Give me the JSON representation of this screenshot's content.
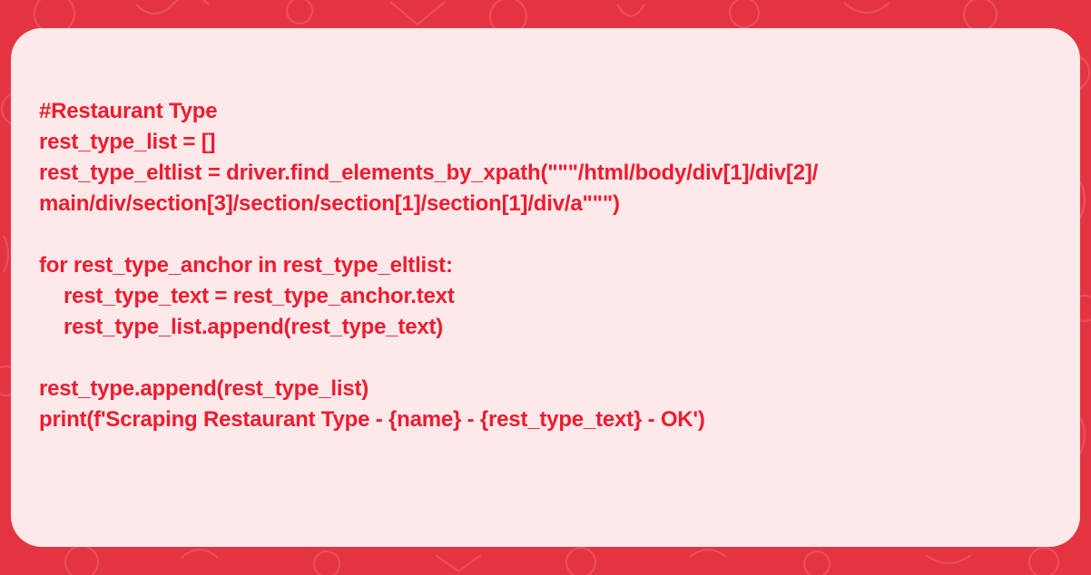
{
  "colors": {
    "background": "#e53441",
    "card": "#fde8ea",
    "code_text": "#ee1c2f"
  },
  "code": {
    "lines": [
      "#Restaurant Type",
      "rest_type_list = []",
      "rest_type_eltlist = driver.find_elements_by_xpath(\"\"\"/html/body/div[1]/div[2]/",
      "main/div/section[3]/section/section[1]/section[1]/div/a\"\"\")",
      "",
      "for rest_type_anchor in rest_type_eltlist:",
      "rest_type_text = rest_type_anchor.text",
      "rest_type_list.append(rest_type_text)",
      "",
      "rest_type.append(rest_type_list)",
      "print(f'Scraping Restaurant Type - {name} - {rest_type_text} - OK')"
    ]
  }
}
